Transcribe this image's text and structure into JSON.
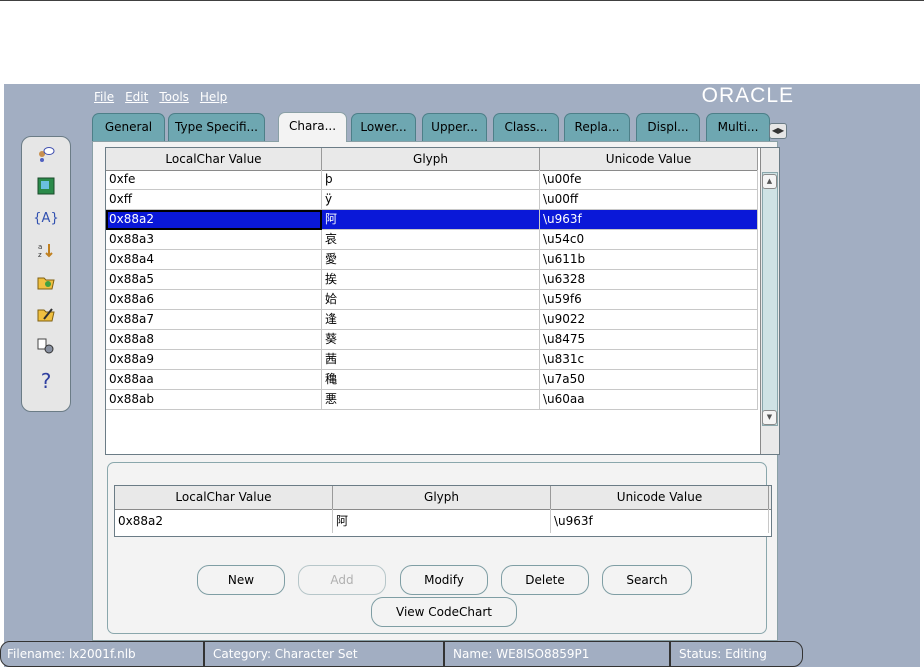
{
  "menu": [
    "File",
    "Edit",
    "Tools",
    "Help"
  ],
  "logo_text": "ORACLE",
  "tabs": [
    {
      "label": "General"
    },
    {
      "label": "Type Specifi..."
    },
    {
      "label": "Chara..."
    },
    {
      "label": "Lower..."
    },
    {
      "label": "Upper..."
    },
    {
      "label": "Class..."
    },
    {
      "label": "Repla..."
    },
    {
      "label": "Displ..."
    },
    {
      "label": "Multi..."
    }
  ],
  "toolbar_icons": [
    "users-icon",
    "image-icon",
    "braces-icon",
    "sort-icon",
    "open-folder-icon",
    "edit-folder-icon",
    "settings-icon",
    "help-icon"
  ],
  "table": {
    "columns": [
      "LocalChar Value",
      "Glyph",
      "Unicode Value"
    ],
    "rows": [
      {
        "local": "0xfe",
        "glyph": "þ",
        "unicode": "\\u00fe"
      },
      {
        "local": "0xff",
        "glyph": "ÿ",
        "unicode": "\\u00ff"
      },
      {
        "local": "0x88a2",
        "glyph": "阿",
        "unicode": "\\u963f",
        "selected": true
      },
      {
        "local": "0x88a3",
        "glyph": "哀",
        "unicode": "\\u54c0"
      },
      {
        "local": "0x88a4",
        "glyph": "愛",
        "unicode": "\\u611b"
      },
      {
        "local": "0x88a5",
        "glyph": "挨",
        "unicode": "\\u6328"
      },
      {
        "local": "0x88a6",
        "glyph": "姶",
        "unicode": "\\u59f6"
      },
      {
        "local": "0x88a7",
        "glyph": "逢",
        "unicode": "\\u9022"
      },
      {
        "local": "0x88a8",
        "glyph": "葵",
        "unicode": "\\u8475"
      },
      {
        "local": "0x88a9",
        "glyph": "茜",
        "unicode": "\\u831c"
      },
      {
        "local": "0x88aa",
        "glyph": "穐",
        "unicode": "\\u7a50"
      },
      {
        "local": "0x88ab",
        "glyph": "悪",
        "unicode": "\\u60aa"
      }
    ]
  },
  "editor": {
    "columns": [
      "LocalChar Value",
      "Glyph",
      "Unicode Value"
    ],
    "local": "0x88a2",
    "glyph": "阿",
    "unicode": "\\u963f"
  },
  "buttons": {
    "new": "New",
    "add": "Add",
    "modify": "Modify",
    "delete": "Delete",
    "search": "Search",
    "view_codechart": "View CodeChart"
  },
  "status": {
    "filename": "Filename: lx2001f.nlb",
    "category": "Category: Character Set",
    "name": "Name: WE8ISO8859P1",
    "status": "Status: Editing"
  }
}
